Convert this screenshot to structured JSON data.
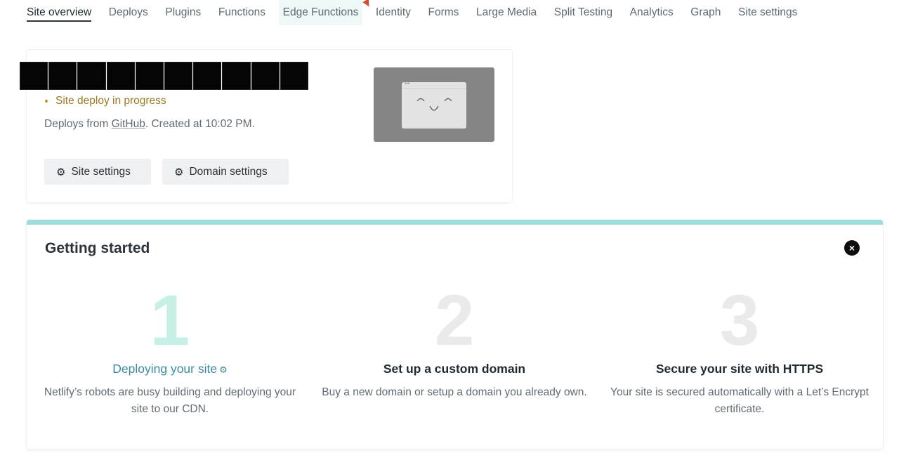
{
  "nav": {
    "tabs": [
      {
        "label": "Site overview"
      },
      {
        "label": "Deploys"
      },
      {
        "label": "Plugins"
      },
      {
        "label": "Functions"
      },
      {
        "label": "Edge Functions"
      },
      {
        "label": "Identity"
      },
      {
        "label": "Forms"
      },
      {
        "label": "Large Media"
      },
      {
        "label": "Split Testing"
      },
      {
        "label": "Analytics"
      },
      {
        "label": "Graph"
      },
      {
        "label": "Site settings"
      }
    ]
  },
  "site": {
    "status": "Site deploy in progress",
    "deploys_from_prefix": "Deploys from ",
    "provider": "GitHub",
    "created_suffix": ". Created at 10:02 PM.",
    "site_settings_label": "Site settings",
    "domain_settings_label": "Domain settings",
    "status_color": "#9b7a23"
  },
  "getting_started": {
    "title": "Getting started",
    "close_icon": "close-icon",
    "steps": [
      {
        "number": "1",
        "heading": "Deploying your site",
        "description": "Netlify’s robots are busy building and deploying your site to our CDN."
      },
      {
        "number": "2",
        "heading": "Set up a custom domain",
        "description": "Buy a new domain or setup a domain you already own."
      },
      {
        "number": "3",
        "heading": "Secure your site with HTTPS",
        "description": "Your site is secured automatically with a Let’s Encrypt certificate."
      }
    ],
    "accent_color": "#9fdcdc"
  }
}
